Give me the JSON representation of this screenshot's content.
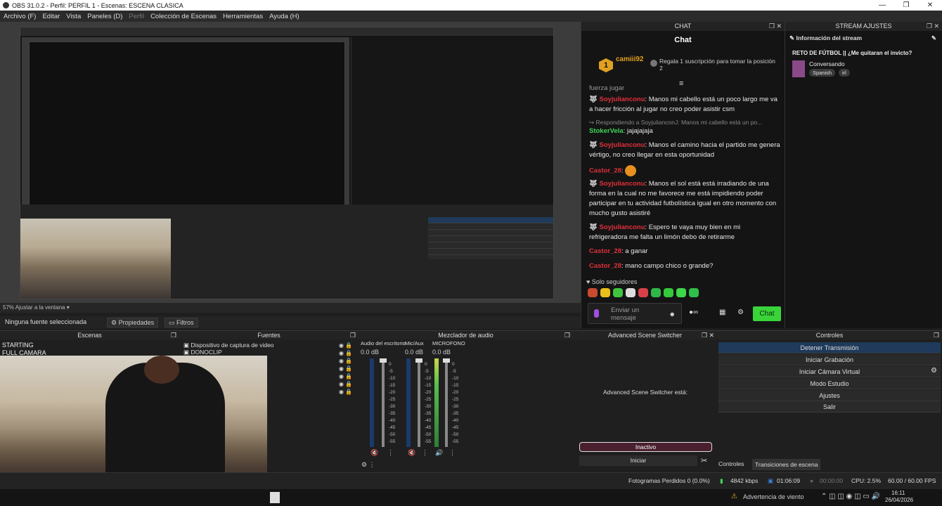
{
  "window": {
    "title": "OBS 31.0.2 - Perfil: PERFIL 1 - Escenas: ESCENA CLASICA",
    "controls": [
      "—",
      "❐",
      "✕"
    ]
  },
  "menu": [
    "Archivo (F)",
    "Editar",
    "Vista",
    "Paneles (D)",
    "Perfil",
    "Colección de Escenas",
    "Herramientas",
    "Ayuda (H)"
  ],
  "preview": {
    "zoom_label": "57% Ajustar a la ventana",
    "no_source": "Ninguna fuente seleccionada",
    "properties_btn": "Propiedades",
    "filters_btn": "Filtros"
  },
  "chat": {
    "dock_title": "CHAT",
    "title": "Chat",
    "pinned_user": "camiii92",
    "pinned_badge": "1",
    "pinned_text": "Regala 1 suscripción para tomar la posición 2",
    "cut_message": "fuerza jugar",
    "messages": [
      {
        "user": "Soyjulianconu",
        "text": ": Manos mi cabello está un poco largo me va a hacer fricción al jugar no creo poder asistir csm"
      },
      {
        "reply": "Respondiendo a SoyjulianconJ: Manos mi cabello está un po..."
      },
      {
        "user": "StokerVela",
        "text": ": jajajajaja"
      },
      {
        "user": "Soyjulianconu",
        "text": ": Manos el camino hacia el partido me genera vértigo, no creo llegar en esta oportunidad"
      },
      {
        "user": "Castor_28",
        "text": ":"
      },
      {
        "user": "Soyjulianconu",
        "text": ": Manos el sol está está irradiando de una forma en la cual no me favorece me está impidiendo poder participar en tu actividad futbolística igual en otro momento con mucho gusto asistiré"
      },
      {
        "user": "Soyjulianconu",
        "text": ": Espero te vaya muy bien en mi refrigeradora me falta un limón debo de retirarme"
      },
      {
        "user": "Castor_28",
        "text": ": a ganar"
      },
      {
        "user": "Castor_28",
        "text": ": mano campo chico o grande?"
      }
    ],
    "followers_only": "Solo seguidores",
    "input_placeholder": "Enviar un mensaje",
    "send_btn": "Chat"
  },
  "stream": {
    "dock_title": "STREAM AJUSTES",
    "info_title": "Información del stream",
    "stream_title": "RETO DE FÚTBOL || ¿Me quitaran el invicto?",
    "category": "Conversando",
    "tags": [
      "Spanish",
      "irl"
    ]
  },
  "scenes": {
    "title": "Escenas",
    "items": [
      "STARTING",
      "FULL CAMARA"
    ]
  },
  "sources": {
    "title": "Fuentes",
    "items": [
      "Dispositivo de captura de video",
      "DONOCLIP"
    ]
  },
  "mixer": {
    "title": "Mezclador de audio",
    "channels": [
      {
        "name": "Audio del escritorio",
        "db": "0.0 dB"
      },
      {
        "name": "Mic/Aux",
        "db": "0.0 dB"
      },
      {
        "name": "MICROFONO",
        "db": "0.0 dB"
      }
    ],
    "scale": [
      "0",
      "-5",
      "-10",
      "-15",
      "-20",
      "-25",
      "-30",
      "-35",
      "-40",
      "-45",
      "-50",
      "-55",
      "-60"
    ]
  },
  "switcher": {
    "title": "Advanced Scene Switcher",
    "status": "Advanced Scene Switcher está:",
    "inactive": "Inactivo",
    "start": "Iniciar"
  },
  "controls": {
    "title": "Controles",
    "buttons": [
      "Detener Transmisión",
      "Iniciar Grabación",
      "Iniciar Cámara Virtual",
      "Modo Estudio",
      "Ajustes",
      "Salir"
    ],
    "tabs": [
      "Controles",
      "Transiciones de escena"
    ]
  },
  "status": {
    "dropped": "Fotogramas Perdidos 0 (0.0%)",
    "bitrate": "4842 kbps",
    "live_time": "01:06:09",
    "rec_time": "00:00:00",
    "cpu": "CPU: 2.5%",
    "fps": "60.00 / 60.00 FPS"
  },
  "taskbar": {
    "weather": "Advertencia de viento",
    "time": "16:11",
    "date": "26/04/2026"
  },
  "colors": {
    "accent_green": "#38d43a",
    "username_red": "#e0303a",
    "username_green": "#3fd45a",
    "active_control": "#1f3a5a"
  }
}
